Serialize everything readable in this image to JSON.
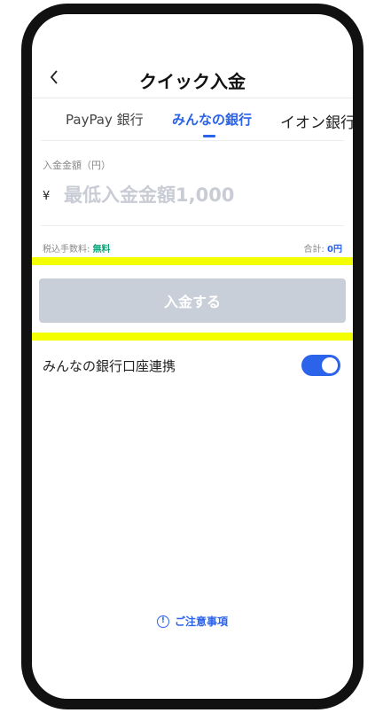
{
  "header": {
    "title": "クイック入金"
  },
  "tabs": [
    {
      "label": "PayPay 銀行"
    },
    {
      "label": "みんなの銀行"
    },
    {
      "label": "イオン銀行"
    }
  ],
  "amount": {
    "label": "入金金額（円）",
    "currency_symbol": "¥",
    "placeholder": "最低入金金額1,000",
    "value": ""
  },
  "fee": {
    "label": "税込手数料:",
    "value": "無料",
    "total_label": "合計:",
    "total_value": "0円"
  },
  "deposit_button": {
    "label": "入金する"
  },
  "bank_link": {
    "label": "みんなの銀行口座連携",
    "enabled": true
  },
  "notice": {
    "label": "ご注意事項"
  },
  "colors": {
    "accent": "#2b63ea",
    "free_text": "#17a37a",
    "highlight": "#f3ff00",
    "button_disabled": "#c9cfd8"
  }
}
